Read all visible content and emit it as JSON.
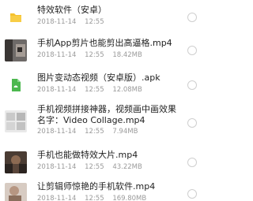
{
  "files": [
    {
      "icon": "folder-icon",
      "name": "特效软件（安卓）",
      "date": "2018-11-14",
      "time": "12:55",
      "size": ""
    },
    {
      "icon": "video-thumbnail",
      "name": "手机App剪片也能剪出高逼格.mp4",
      "date": "2018-11-14",
      "time": "12:55",
      "size": "18.42MB"
    },
    {
      "icon": "apk-file-icon",
      "name": "图片变动态视频（安卓版）.apk",
      "date": "2018-11-14",
      "time": "12:55",
      "size": "12.08MB"
    },
    {
      "icon": "video-thumbnail",
      "name": "手机视频拼接神器，视频画中画效果 名字：Video Collage.mp4",
      "date": "2018-11-14",
      "time": "12:55",
      "size": "7.94MB"
    },
    {
      "icon": "video-thumbnail",
      "name": "手机也能做特效大片.mp4",
      "date": "2018-11-14",
      "time": "12:55",
      "size": "43.22MB"
    },
    {
      "icon": "video-thumbnail",
      "name": "让剪辑师惊艳的手机软件.mp4",
      "date": "2018-11-14",
      "time": "12:55",
      "size": "169.80MB"
    }
  ],
  "colors": {
    "folder": "#f5c12e",
    "apk": "#4cb84f",
    "meta_text": "#9a9a9a",
    "name_text": "#222222"
  }
}
